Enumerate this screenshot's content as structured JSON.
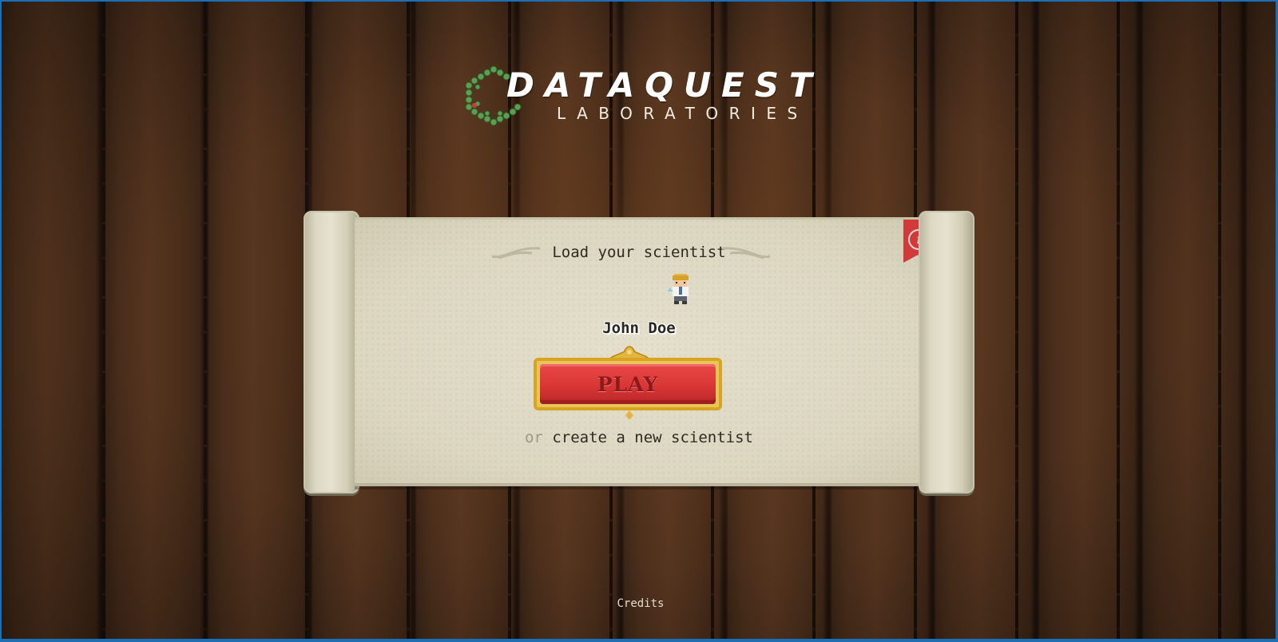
{
  "logo": {
    "title": "DATAQUEST",
    "subtitle": "LABORATORIES"
  },
  "scroll": {
    "heading": "Load your scientist",
    "player_name": "John Doe",
    "play_label": "PLAY",
    "or_text": "or",
    "create_link": "create a new scientist",
    "info_icon": "info-icon"
  },
  "footer": {
    "credits": "Credits"
  },
  "colors": {
    "play_red": "#d93636",
    "play_gold": "#d9a520",
    "ribbon_red": "#d23a3a",
    "logo_green": "#5d9e53",
    "wood_dark": "#3b2516"
  }
}
